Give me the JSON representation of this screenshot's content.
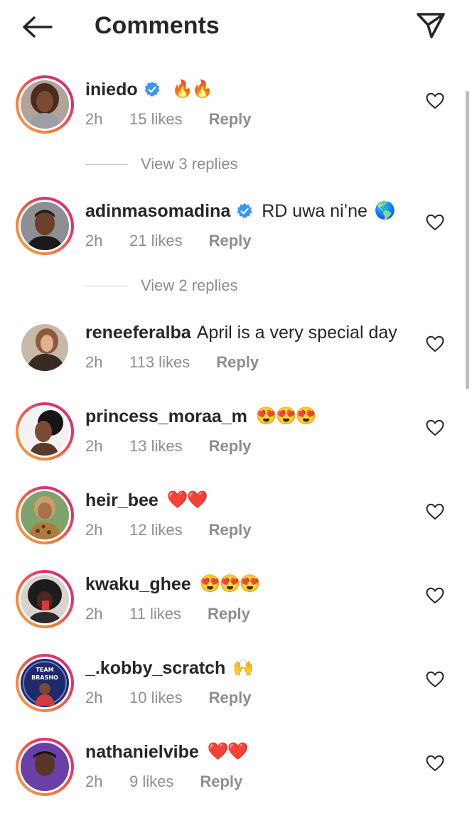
{
  "header": {
    "title": "Comments",
    "back_icon": "arrow-left-icon",
    "send_icon": "paper-plane-icon"
  },
  "colors": {
    "text": "#262626",
    "secondary": "#8e8e8e",
    "verified": "#3897f0",
    "story_ring_start": "#f9a54a",
    "story_ring_end": "#c13584"
  },
  "comments": [
    {
      "username": "iniedo",
      "verified": true,
      "text": "",
      "emoji": "🔥🔥",
      "time": "2h",
      "likes": "15 likes",
      "reply": "Reply",
      "view_replies": "View 3 replies",
      "story_ring": true
    },
    {
      "username": "adinmasomadina",
      "verified": true,
      "text": "RD uwa ni’ne",
      "emoji": "🌎",
      "time": "2h",
      "likes": "21 likes",
      "reply": "Reply",
      "view_replies": "View 2 replies",
      "story_ring": true
    },
    {
      "username": "reneeferalba",
      "verified": false,
      "text": "April is a very special day",
      "emoji": "",
      "time": "2h",
      "likes": "113 likes",
      "reply": "Reply",
      "story_ring": false
    },
    {
      "username": "princess_moraa_m",
      "verified": false,
      "text": "",
      "emoji": "😍😍😍",
      "time": "2h",
      "likes": "13 likes",
      "reply": "Reply",
      "story_ring": true
    },
    {
      "username": "heir_bee",
      "verified": false,
      "text": "",
      "emoji": "❤️❤️",
      "time": "2h",
      "likes": "12 likes",
      "reply": "Reply",
      "story_ring": true
    },
    {
      "username": "kwaku_ghee",
      "verified": false,
      "text": "",
      "emoji": "😍😍😍",
      "time": "2h",
      "likes": "11 likes",
      "reply": "Reply",
      "story_ring": true
    },
    {
      "username": "_.kobby_scratch",
      "verified": false,
      "text": "",
      "emoji": "🙌",
      "time": "2h",
      "likes": "10 likes",
      "reply": "Reply",
      "story_ring": true,
      "avatar_text": [
        "TEAM",
        "BRASHO"
      ]
    },
    {
      "username": "nathanielvibe",
      "verified": false,
      "text": "",
      "emoji": "❤️❤️",
      "time": "2h",
      "likes": "9 likes",
      "reply": "Reply",
      "story_ring": true
    }
  ]
}
